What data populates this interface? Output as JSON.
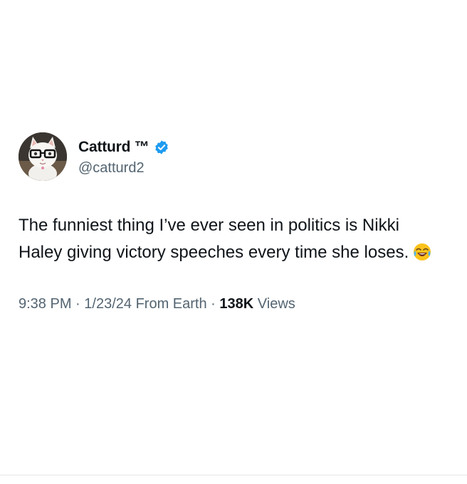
{
  "author": {
    "display_name": "Catturd ™",
    "handle": "@catturd2",
    "verified": true,
    "verified_color": "#1d9bf0",
    "avatar_icon": "cat-with-glasses-avatar"
  },
  "tweet": {
    "text": "The funniest thing I’ve ever seen in politics is Nikki Haley giving victory speeches every time she loses.",
    "emoji": "face-with-tears-of-joy"
  },
  "meta": {
    "time": "9:38 PM",
    "separator": "·",
    "date": "1/23/24",
    "location": "From Earth",
    "views_count": "138K",
    "views_label": "Views"
  },
  "colors": {
    "text_primary": "#0f1419",
    "text_secondary": "#536471",
    "background": "#ffffff"
  }
}
